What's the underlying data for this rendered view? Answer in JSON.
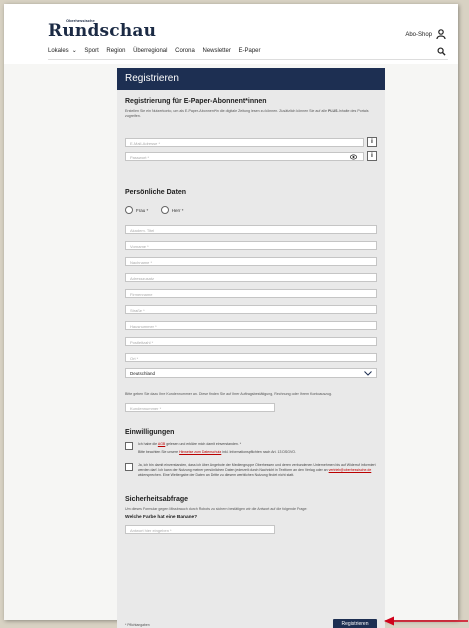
{
  "header": {
    "logo_small": "Oberhessische",
    "logo": "Rundschau",
    "abo_shop": "Abo-Shop",
    "nav": [
      "Lokales",
      "Sport",
      "Region",
      "Überregional",
      "Corona",
      "Newsletter",
      "E-Paper"
    ]
  },
  "form": {
    "title": "Registrieren",
    "section1": {
      "heading": "Registrierung für E-Paper-Abonnent*innen",
      "text_before": "Erstellen Sie ein Nutzerkonto, um als E-Paper-Abonnent*in die digitale Zeitung lesen zu können. Zusätzlich können Sie auf alle ",
      "plus": "PLUS",
      "text_after": "-Inhalte des Portals zugreifen.",
      "email_placeholder": "E-Mail-Adresse *",
      "password_placeholder": "Passwort *"
    },
    "section2": {
      "heading": "Persönliche Daten",
      "salutations": [
        "Frau *",
        "Herr *"
      ],
      "fields": [
        "Akadem. Titel",
        "Vorname *",
        "Nachname *",
        "Adresszusatz",
        "Firmenname",
        "Straße *",
        "Hausnummer *",
        "Postleitzahl *",
        "Ort *"
      ],
      "country": "Deutschland",
      "customer_hint": "Bitte geben Sie dazu Ihre Kundennummer an. Diese finden Sie auf Ihrer Auftragsbestätigung, Rechnung oder Ihrem Kontoauszug.",
      "customer_placeholder": "Kundennummer *"
    },
    "section3": {
      "heading": "Einwilligungen",
      "agb_before": "Ich habe die ",
      "agb_link": "AGB",
      "agb_after": " gelesen und erkläre mich damit einverstanden. *",
      "privacy_before": "Bitte beachten Sie unsere ",
      "privacy_link": "Hinweise zum Datenschutz",
      "privacy_after": " inkl. Informationspflichten nach Art. 13 DSGVO.",
      "marketing_text": "Ja, ich bin damit einverstanden, dass ich über Angebote der Mediengruppe Oberhessen und deren verbundenen Unternehmen bis auf Widerruf informiert werden darf. Ich kann der Nutzung meiner persönlichen Daten jederzeit durch Nachricht in Textform an den Verlag oder an ",
      "marketing_link": "vertrieb@oberhessische.de",
      "marketing_after": " widersprechen. Eine Weitergabe der Daten an Dritte zu diesem werblichen Nutzung findet nicht statt."
    },
    "section4": {
      "heading": "Sicherheitsabfrage",
      "text": "Um dieses Formular gegen Missbrauch durch Robots zu sichern bestätigen wir die Antwort auf die folgende Frage:",
      "question": "Welche Farbe hat eine Banane?",
      "answer_placeholder": "Antwort hier eingeben *"
    },
    "required_note": "* Pflichtangaben",
    "submit": "Registrieren"
  },
  "colors": {
    "navy": "#1d2f52",
    "arrow": "#d0021b"
  }
}
